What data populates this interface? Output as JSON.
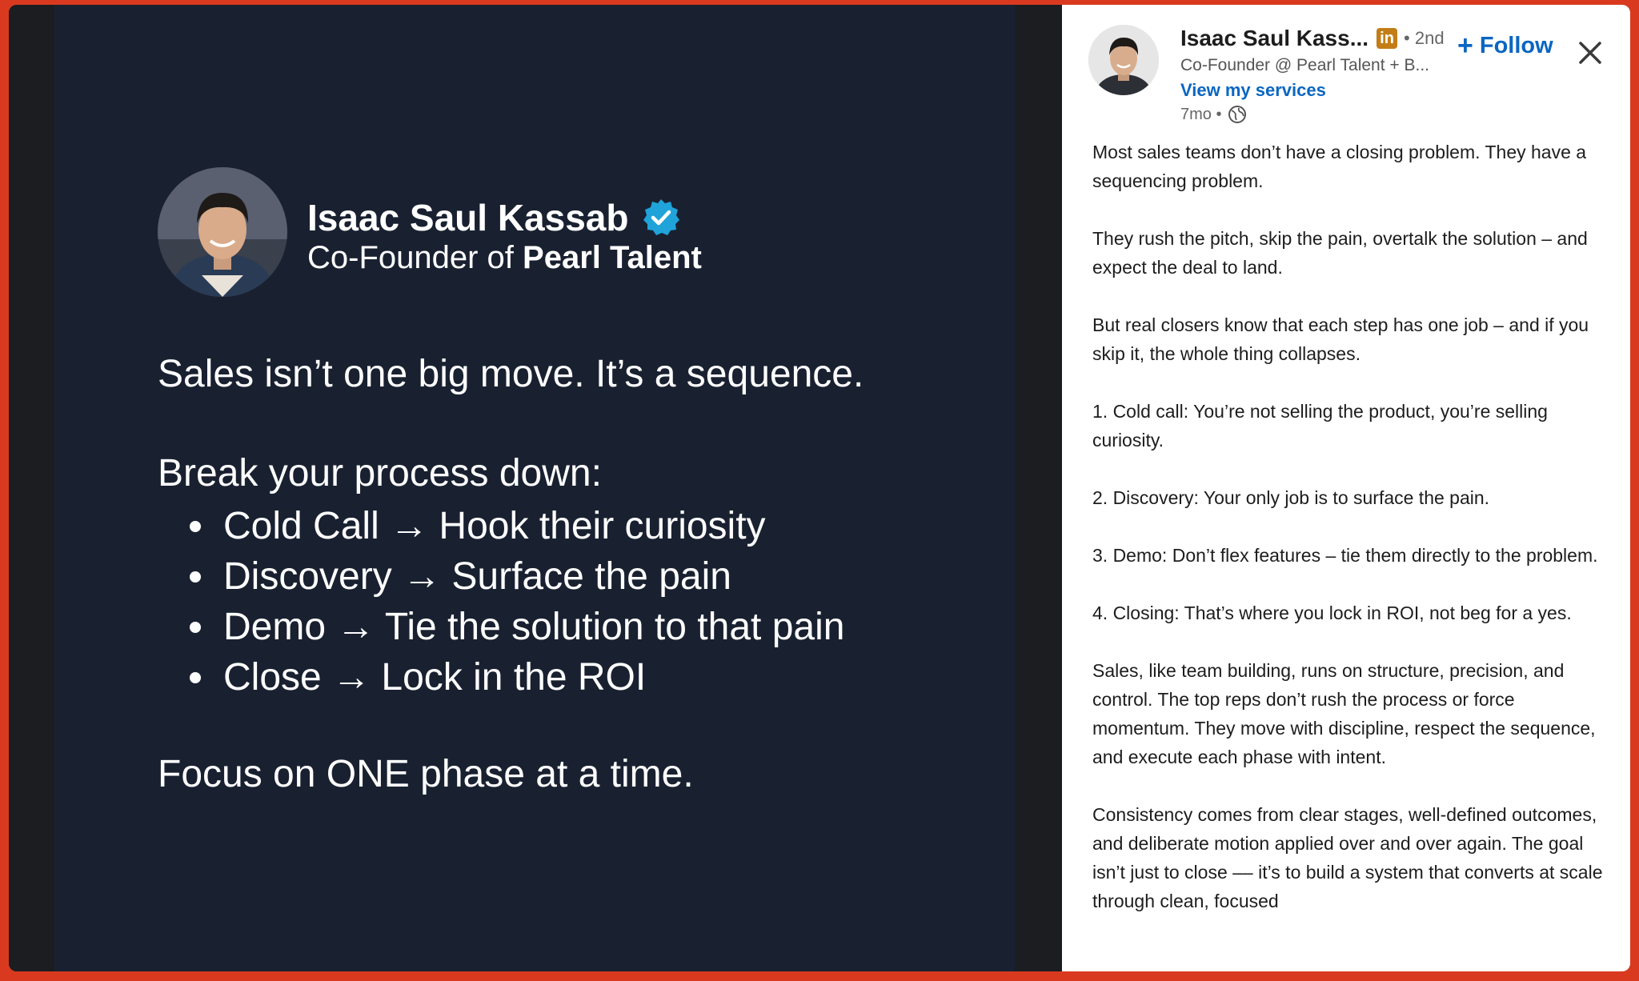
{
  "slide": {
    "name": "Isaac Saul Kassab",
    "role_prefix": "Co-Founder of",
    "role_company": "Pearl Talent",
    "headline": "Sales isn’t one big move. It’s a sequence.",
    "lead": "Break your process down:",
    "steps": [
      "Cold Call → Hook their curiosity",
      "Discovery → Surface the pain",
      "Demo → Tie the solution to that pain",
      "Close → Lock in the ROI"
    ],
    "focus": "Focus on ONE phase at a time."
  },
  "post": {
    "author_name": "Isaac Saul Kass...",
    "network_badge": "in",
    "degree": "• 2nd",
    "follow_label": "Follow",
    "headline": "Co-Founder @ Pearl Talent + B...",
    "services_link": "View my services",
    "age": "7mo •",
    "paragraphs": [
      "Most sales teams don’t have a closing problem. They have a sequencing problem.",
      "They rush the pitch, skip the pain, overtalk the solution – and expect the deal to land.",
      "But real closers know that each step has one job – and if you skip it, the whole thing collapses.",
      "1. Cold call: You’re not selling the product, you’re selling curiosity.",
      "2. Discovery: Your only job is to surface the pain.",
      "3. Demo: Don’t flex features – tie them directly to the problem.",
      "4. Closing: That’s where you lock in ROI, not beg for a yes.",
      "Sales, like team building, runs on structure, precision, and control. The top reps don’t rush the process or force momentum. They move with discipline, respect the sequence, and execute each phase with intent.",
      "Consistency comes from clear stages, well-defined outcomes, and deliberate motion applied over and over again. The goal isn’t just to close –– it’s to build a system that converts at scale through clean, focused"
    ]
  },
  "icons": {
    "verified": "verified-check-icon",
    "close": "close-icon",
    "globe": "globe-icon",
    "plus": "plus-icon"
  },
  "colors": {
    "slide_bg": "#192131",
    "link_blue": "#0a66c2",
    "verified_blue": "#1fa3d9",
    "badge_gold": "#c37d16",
    "outer_border": "#d93a1f"
  }
}
